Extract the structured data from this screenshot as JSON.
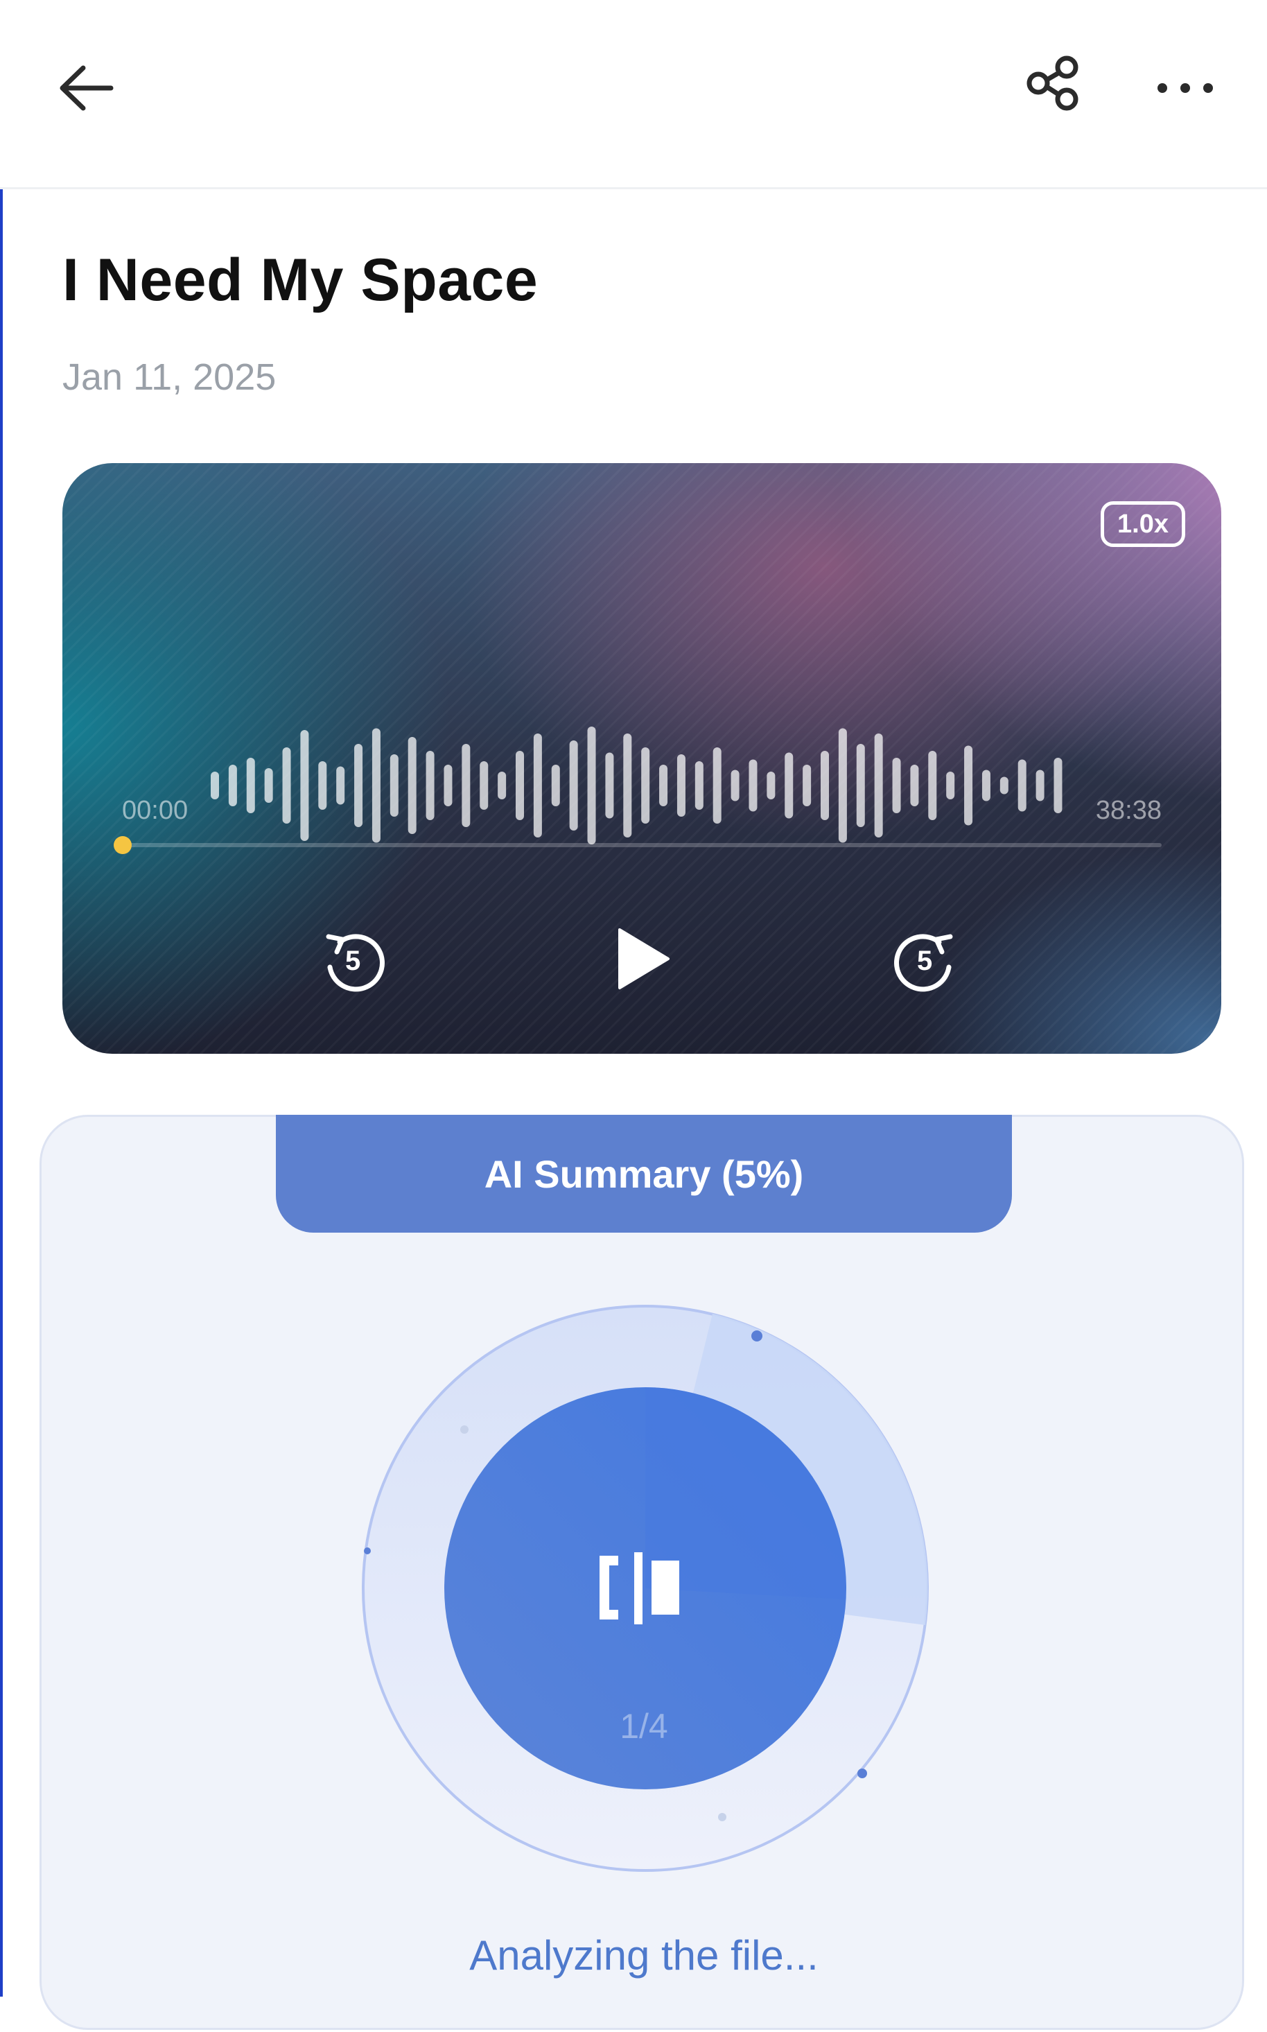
{
  "header": {
    "back_icon": "arrow-left-icon",
    "share_icon": "share-icon",
    "more_icon": "more-horizontal-icon"
  },
  "recording": {
    "title": "I Need My Space",
    "date": "Jan 11, 2025"
  },
  "player": {
    "speed": "1.0x",
    "current_time": "00:00",
    "total_time": "38:38",
    "progress": 0.0,
    "rewind_seconds": "5",
    "forward_seconds": "5",
    "colors": {
      "accent": "#f5c542"
    }
  },
  "summary": {
    "tab_label": "AI Summary (5%)",
    "step": "1/4",
    "status": "Analyzing the file...",
    "colors": {
      "tab": "#5d80cf",
      "core": "#4e7be0",
      "status": "#4e79cc"
    }
  }
}
